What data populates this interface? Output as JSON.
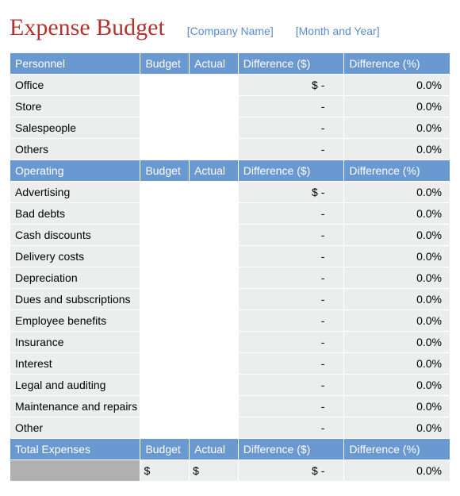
{
  "title": "Expense Budget",
  "company_placeholder": "[Company Name]",
  "period_placeholder": "[Month and Year]",
  "headers": {
    "budget": "Budget",
    "actual": "Actual",
    "diff_dollar": "Difference ($)",
    "diff_percent": "Difference (%)"
  },
  "sections": [
    {
      "name": "Personnel",
      "rows": [
        {
          "label": "Office",
          "budget": "",
          "actual": "",
          "diff_d": "$                -",
          "diff_p": "0.0%"
        },
        {
          "label": "Store",
          "budget": "",
          "actual": "",
          "diff_d": "-",
          "diff_p": "0.0%"
        },
        {
          "label": "Salespeople",
          "budget": "",
          "actual": "",
          "diff_d": "-",
          "diff_p": "0.0%"
        },
        {
          "label": "Others",
          "budget": "",
          "actual": "",
          "diff_d": "-",
          "diff_p": "0.0%"
        }
      ]
    },
    {
      "name": "Operating",
      "rows": [
        {
          "label": "Advertising",
          "budget": "",
          "actual": "",
          "diff_d": "$                -",
          "diff_p": "0.0%"
        },
        {
          "label": "Bad debts",
          "budget": "",
          "actual": "",
          "diff_d": "-",
          "diff_p": "0.0%"
        },
        {
          "label": "Cash discounts",
          "budget": "",
          "actual": "",
          "diff_d": "-",
          "diff_p": "0.0%"
        },
        {
          "label": "Delivery costs",
          "budget": "",
          "actual": "",
          "diff_d": "-",
          "diff_p": "0.0%"
        },
        {
          "label": "Depreciation",
          "budget": "",
          "actual": "",
          "diff_d": "-",
          "diff_p": "0.0%"
        },
        {
          "label": "Dues and subscriptions",
          "budget": "",
          "actual": "",
          "diff_d": "-",
          "diff_p": "0.0%"
        },
        {
          "label": "Employee benefits",
          "budget": "",
          "actual": "",
          "diff_d": "-",
          "diff_p": "0.0%"
        },
        {
          "label": "Insurance",
          "budget": "",
          "actual": "",
          "diff_d": "-",
          "diff_p": "0.0%"
        },
        {
          "label": "Interest",
          "budget": "",
          "actual": "",
          "diff_d": "-",
          "diff_p": "0.0%"
        },
        {
          "label": "Legal and auditing",
          "budget": "",
          "actual": "",
          "diff_d": "-",
          "diff_p": "0.0%"
        },
        {
          "label": "Maintenance and repairs",
          "budget": "",
          "actual": "",
          "diff_d": "-",
          "diff_p": "0.0%"
        },
        {
          "label": "Other",
          "budget": "",
          "actual": "",
          "diff_d": "-",
          "diff_p": "0.0%"
        }
      ]
    }
  ],
  "total": {
    "label": "Total  Expenses",
    "budget": "$",
    "actual": "$",
    "diff_d": "$                -",
    "diff_p": "0.0%"
  }
}
